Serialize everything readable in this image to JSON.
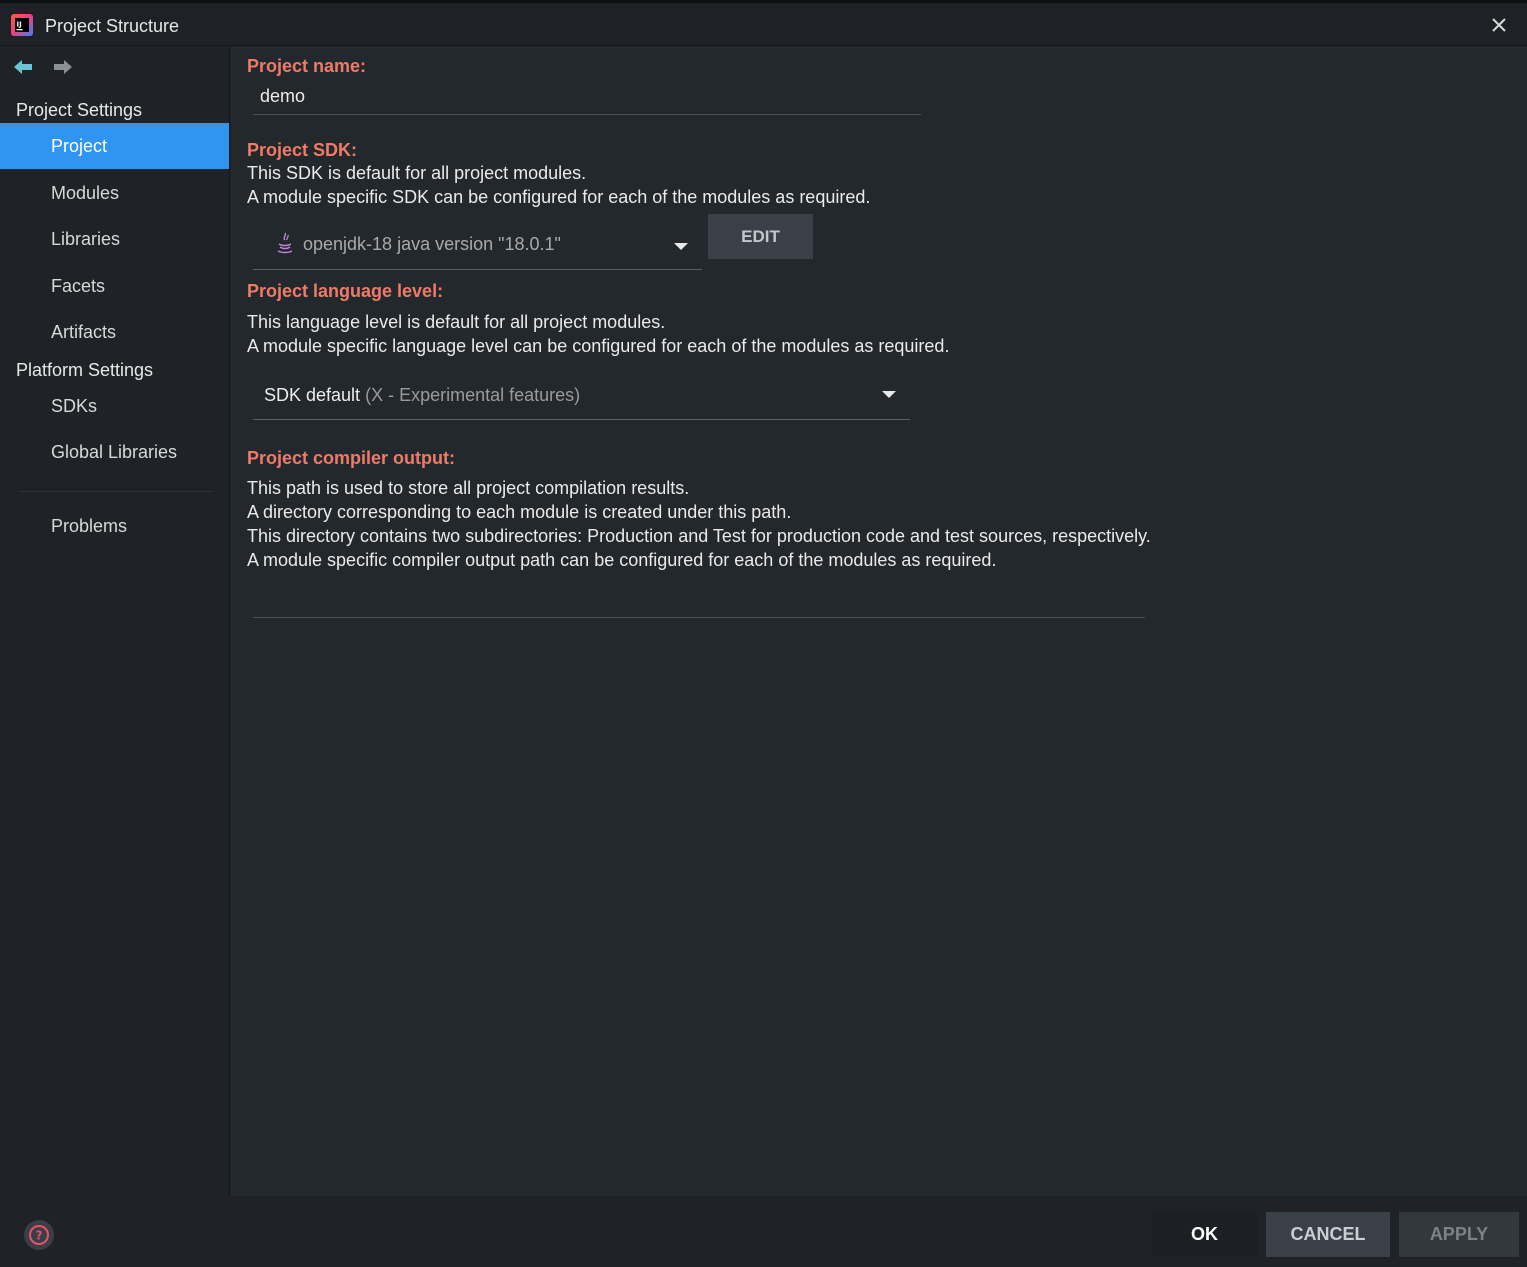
{
  "window": {
    "title": "Project Structure"
  },
  "sidebar": {
    "project_settings_title": "Project Settings",
    "platform_settings_title": "Platform Settings",
    "items": [
      {
        "label": "Project"
      },
      {
        "label": "Modules"
      },
      {
        "label": "Libraries"
      },
      {
        "label": "Facets"
      },
      {
        "label": "Artifacts"
      },
      {
        "label": "SDKs"
      },
      {
        "label": "Global Libraries"
      },
      {
        "label": "Problems"
      }
    ],
    "active_item": "Project"
  },
  "project": {
    "name_label": "Project name:",
    "name_value": "demo",
    "sdk_label": "Project SDK:",
    "sdk_desc1": "This SDK is default for all project modules.",
    "sdk_desc2": "A module specific SDK can be configured for each of the modules as required.",
    "sdk_value": "openjdk-18 java version \"18.0.1\"",
    "edit_button": "EDIT",
    "lang_label": "Project language level:",
    "lang_desc1": "This language level is default for all project modules.",
    "lang_desc2": "A module specific language level can be configured for each of the modules as required.",
    "lang_value": "SDK default",
    "lang_hint": "(X - Experimental features)",
    "output_label": "Project compiler output:",
    "output_desc1": "This path is used to store all project compilation results.",
    "output_desc2": "A directory corresponding to each module is created under this path.",
    "output_desc3": "This directory contains two subdirectories: Production and Test for production code and test sources, respectively.",
    "output_desc4": "A module specific compiler output path can be configured for each of the modules as required.",
    "output_value": ""
  },
  "footer": {
    "ok": "OK",
    "cancel": "CANCEL",
    "apply": "APPLY"
  },
  "colors": {
    "accent": "#2f95f0",
    "label": "#f07a67",
    "background": "#23282d",
    "sidebar": "#1f2327"
  },
  "icons": {
    "app": "intellij-icon",
    "close": "close-icon",
    "back": "arrow-left-icon",
    "forward": "arrow-right-icon",
    "java": "java-icon",
    "dropdown": "chevron-down-icon",
    "folder": "folder-icon",
    "help": "help-icon"
  }
}
